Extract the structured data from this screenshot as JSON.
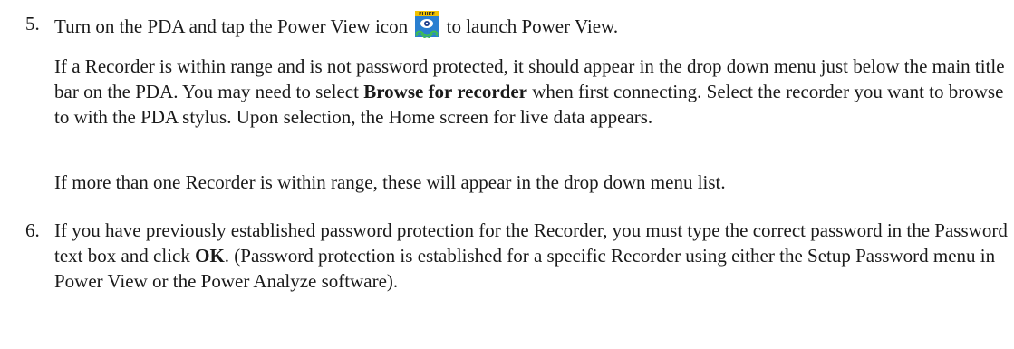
{
  "step5": {
    "number": "5.",
    "line_before_icon": "Turn on the PDA and tap the Power View icon",
    "icon_label": "FLUKE",
    "line_after_icon": "to launch Power View.",
    "para2_a": "If a Recorder is within range and is not password protected, it should appear in the drop down menu just below the main title bar on the PDA. You may need to select ",
    "para2_bold": "Browse for recorder",
    "para2_b": " when first connecting. Select the recorder you want to browse to with the PDA stylus. Upon selection, the Home screen for live data appears.",
    "para3": "If more than one Recorder is within range, these will appear in the drop down menu list."
  },
  "step6": {
    "number": "6.",
    "text_a": "If you have previously established password protection for the Recorder, you must type the correct password in the Password text box and click ",
    "text_bold": "OK",
    "text_b": ". (Password protection is established for a specific Recorder using either the Setup Password menu in Power View or the Power Analyze software)."
  },
  "colors": {
    "text": "#1a1a1a",
    "icon_banner": "#f2c200",
    "icon_body": "#2a7fd0",
    "icon_wave": "#3fbf4f"
  }
}
